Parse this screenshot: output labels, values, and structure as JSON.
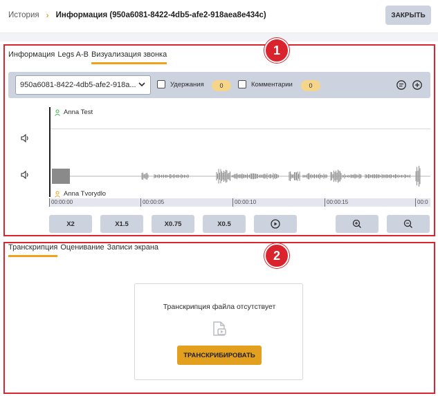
{
  "header": {
    "breadcrumb_root": "История",
    "breadcrumb_separator": "›",
    "breadcrumb_current": "Информация (950a6081-8422-4db5-afe2-918aea8e434c)",
    "close_label": "ЗАКРЫТЬ"
  },
  "badges": {
    "first": "1",
    "second": "2"
  },
  "top_tabs": [
    {
      "label": "Информация",
      "active": false
    },
    {
      "label": "Legs A-B",
      "active": false
    },
    {
      "label": "Визуализация звонка",
      "active": true
    }
  ],
  "toolbar": {
    "call_select_value": "950a6081-8422-4db5-afe2-918a...",
    "holds_label": "Удержания",
    "holds_count": "0",
    "comments_label": "Комментарии",
    "comments_count": "0",
    "icons": [
      "comment-icon",
      "add-comment-icon"
    ]
  },
  "waveform": {
    "speaker_a": "Anna Test",
    "speaker_b": "Anna Tvorydlo",
    "speaker_a_color": "#3bb54a",
    "speaker_b_color": "#f0a21a",
    "timeline": [
      "00:00:00",
      "00:00:05",
      "00:00:10",
      "00:00:15",
      "00:0"
    ]
  },
  "controls": {
    "speed_2": "X2",
    "speed_1_5": "X1.5",
    "speed_0_75": "X0.75",
    "speed_0_5": "X0.5",
    "icons": [
      "play-icon",
      "zoom-in-icon",
      "zoom-out-icon"
    ]
  },
  "bottom_tabs": [
    {
      "label": "Транскрипция",
      "active": true
    },
    {
      "label": "Оценивание",
      "active": false
    },
    {
      "label": "Записи экрана",
      "active": false
    }
  ],
  "transcription": {
    "empty_message": "Транскрипция файла отсутствует",
    "transcribe_label": "ТРАНСКРИБИРОВАТЬ"
  },
  "colors": {
    "accent": "#f0a21a",
    "highlight_border": "#d9232d",
    "toolbar_bg": "#cdd2df",
    "primary_button": "#e3a01f"
  }
}
